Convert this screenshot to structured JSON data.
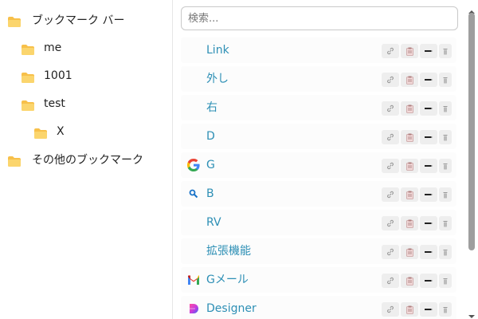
{
  "sidebar": {
    "folders": [
      {
        "label": "ブックマーク バー"
      },
      {
        "label": "me"
      },
      {
        "label": "1001"
      },
      {
        "label": "test"
      },
      {
        "label": "X"
      },
      {
        "label": "その他のブックマーク"
      }
    ]
  },
  "search": {
    "placeholder": "検索..."
  },
  "bookmarks": [
    {
      "title": "Link",
      "icon": "none"
    },
    {
      "title": "外し",
      "icon": "none"
    },
    {
      "title": "右",
      "icon": "none"
    },
    {
      "title": "D",
      "icon": "none"
    },
    {
      "title": "G",
      "icon": "google-icon"
    },
    {
      "title": "B",
      "icon": "search-icon"
    },
    {
      "title": "RV",
      "icon": "none"
    },
    {
      "title": "拡張機能",
      "icon": "none"
    },
    {
      "title": "Gメール",
      "icon": "gmail-icon"
    },
    {
      "title": "Designer",
      "icon": "designer-icon"
    }
  ],
  "row_actions": [
    "link-icon",
    "clipboard-icon",
    "edit-icon",
    "delete-icon"
  ],
  "colors": {
    "folder": "#f7c04a",
    "link_text": "#2d8fb5",
    "action_bg": "#eeeeee",
    "scrollbar": "#9e9e9e"
  }
}
